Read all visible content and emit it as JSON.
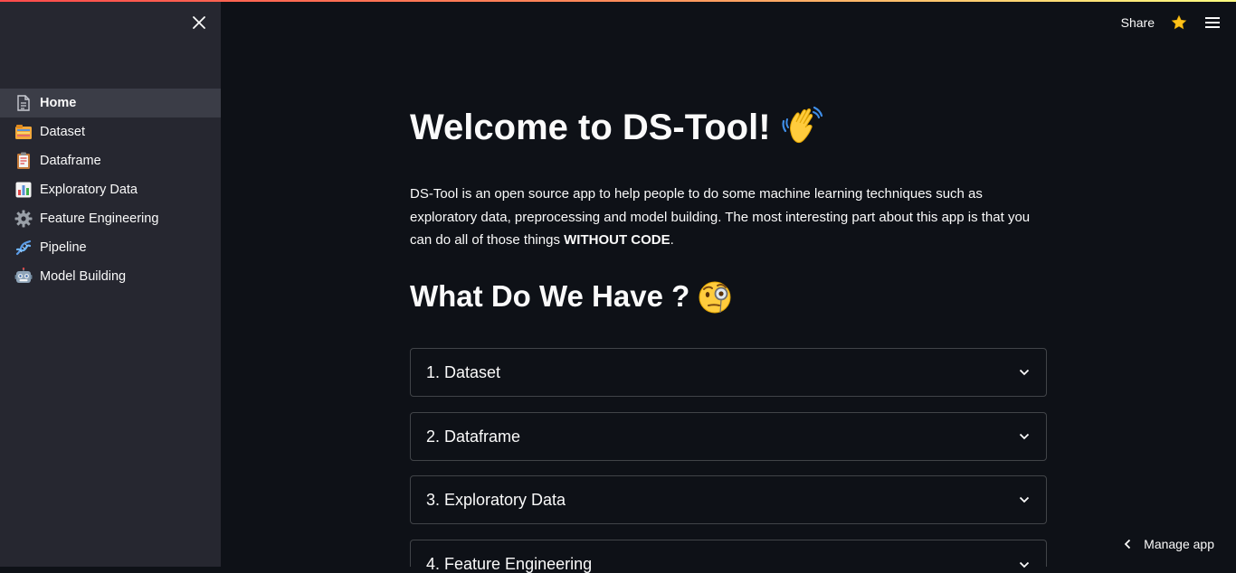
{
  "header": {
    "share_label": "Share"
  },
  "sidebar": {
    "items": [
      {
        "label": "Home",
        "icon": "document-icon",
        "active": true
      },
      {
        "label": "Dataset",
        "icon": "card-index-dividers-icon"
      },
      {
        "label": "Dataframe",
        "icon": "clipboard-icon"
      },
      {
        "label": "Exploratory Data",
        "icon": "bar-chart-icon"
      },
      {
        "label": "Feature Engineering",
        "icon": "gear-icon"
      },
      {
        "label": "Pipeline",
        "icon": "dna-icon"
      },
      {
        "label": "Model Building",
        "icon": "robot-icon"
      }
    ]
  },
  "main": {
    "title": "Welcome to DS-Tool!",
    "intro_text": "DS-Tool is an open source app to help people to do some machine learning techniques such as exploratory data, preprocessing and model building. The most interesting part about this app is that you can do all of those things ",
    "intro_bold": "WITHOUT CODE",
    "intro_end": ".",
    "subtitle": "What Do We Have ?",
    "expanders": [
      {
        "label": "1. Dataset"
      },
      {
        "label": "2. Dataframe"
      },
      {
        "label": "3. Exploratory Data"
      },
      {
        "label": "4. Feature Engineering"
      }
    ]
  },
  "footer": {
    "manage_app_label": "Manage app"
  },
  "colors": {
    "background": "#0e1117",
    "sidebar": "#262730",
    "active_item": "#3b3d47",
    "accent_red": "#ff4b4b"
  }
}
